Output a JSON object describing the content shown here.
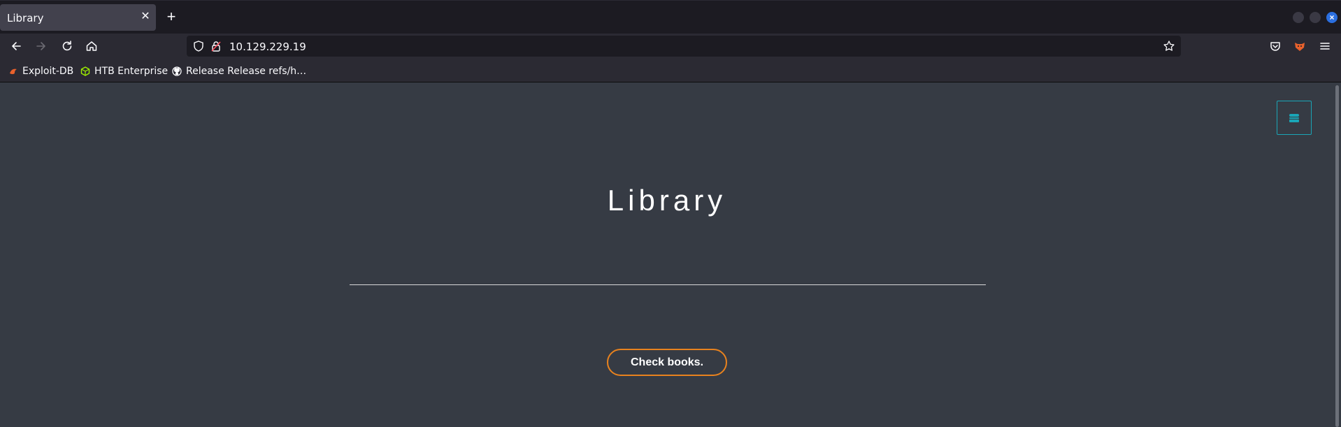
{
  "tab": {
    "title": "Library",
    "close_icon": "close-icon",
    "new_tab_icon": "plus-icon"
  },
  "window_controls": {
    "minimize": "minimize-icon",
    "maximize": "maximize-icon",
    "close": "close-icon"
  },
  "nav": {
    "back_icon": "arrow-left-icon",
    "forward_icon": "arrow-right-icon",
    "reload_icon": "reload-icon",
    "home_icon": "home-icon",
    "url": "10.129.229.19",
    "shield_icon": "shield-icon",
    "lock_icon": "insecure-lock-icon",
    "bookmark_star_icon": "star-icon",
    "pocket_icon": "pocket-icon",
    "extension_icon": "fox-extension-icon",
    "menu_icon": "hamburger-menu-icon"
  },
  "bookmarks": [
    {
      "label": "Exploit-DB",
      "icon": "exploitdb-icon",
      "color": "#e8612c"
    },
    {
      "label": "HTB Enterprise",
      "icon": "htb-cube-icon",
      "color": "#9fef00"
    },
    {
      "label": "Release Release refs/h…",
      "icon": "github-icon",
      "color": "#fbfbfe"
    }
  ],
  "page": {
    "title": "Library",
    "button_label": "Check books.",
    "menu_icon": "hamburger-icon",
    "accent_teal": "#1aa6b7",
    "accent_orange": "#e8821e",
    "background": "#363b44"
  }
}
